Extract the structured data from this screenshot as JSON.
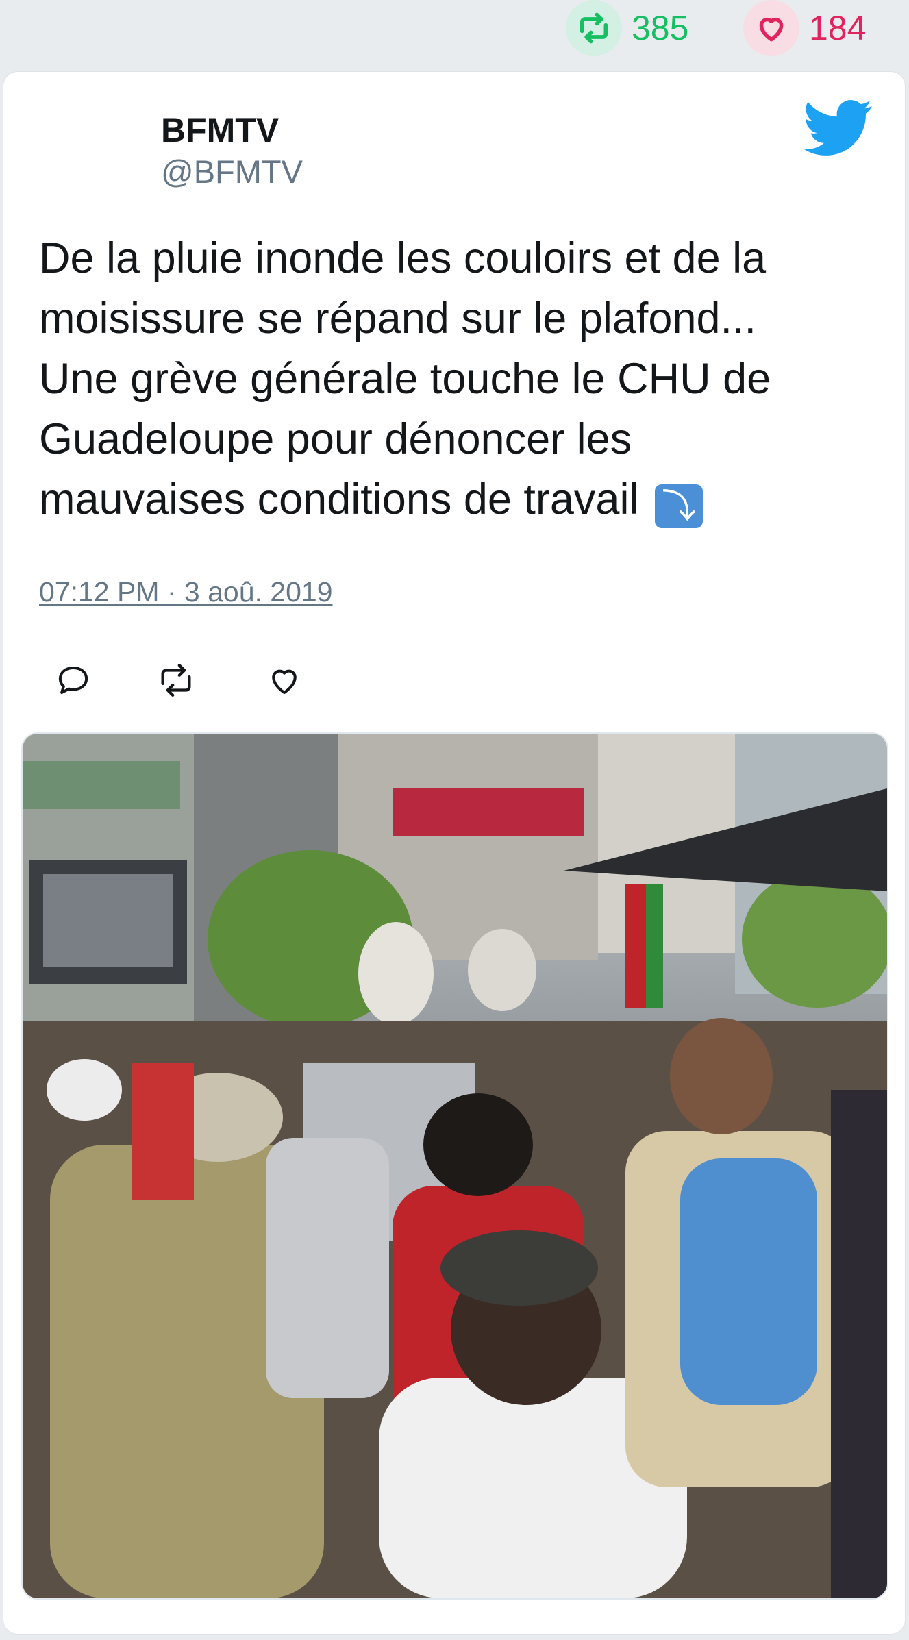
{
  "stats": {
    "retweets": "385",
    "likes": "184"
  },
  "tweet": {
    "author_name": "BFMTV",
    "author_handle": "@BFMTV",
    "text_lines": [
      "De la pluie inonde les couloirs et de la",
      "moisissure se répand sur le plafond...",
      "Une grève générale touche le CHU de",
      "Guadeloupe pour dénoncer les",
      "mauvaises conditions de travail"
    ],
    "emoji": "⤵",
    "timestamp": "07:12 PM · 3 aoû. 2019"
  },
  "colors": {
    "retweet_green": "#17bf63",
    "like_red": "#e0245e",
    "twitter_blue": "#1da1f2",
    "secondary_text": "#657786"
  },
  "icons": {
    "retweet": "retweet-icon",
    "like": "heart-icon",
    "reply": "reply-icon",
    "logo": "twitter-bird-icon"
  }
}
